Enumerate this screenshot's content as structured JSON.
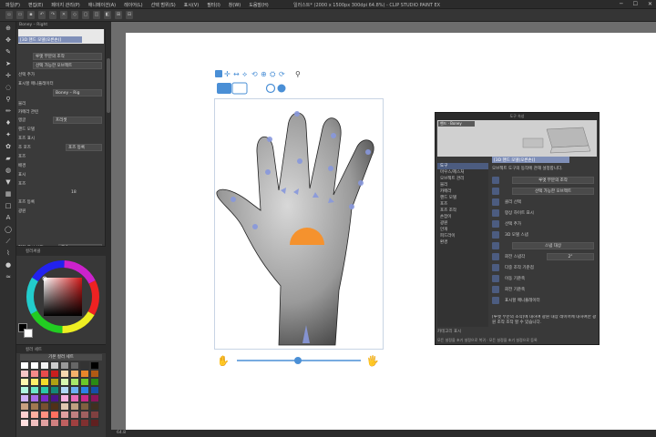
{
  "app": {
    "title": "일러스트* (2000 x 1500px 300dpi 64.8%) - CLIP STUDIO PAINT EX",
    "menu": [
      "파일(F)",
      "편집(E)",
      "페이지 관리(P)",
      "애니메이션(A)",
      "레이어(L)",
      "선택 범위(S)",
      "표시(V)",
      "필터(I)",
      "창(W)",
      "도움말(H)"
    ],
    "window_controls": [
      "─",
      "☐",
      "✕"
    ]
  },
  "subtool": {
    "header": "Boney – Right",
    "selected": "[3D 핸드 모델(오른손)]",
    "rows": [
      "루엣 부분의 조작",
      "선택 가능한 오브젝트",
      "선택 추가",
      "표시할 매니퓰레이터",
      "Boney – Rig",
      "물리",
      "카메라 관련",
      "앵글",
      "프리셋",
      "핸드 모델",
      "포즈 표시",
      "조 포즈",
      "포즈 등록",
      "포즈",
      "배경",
      "표시",
      "포즈",
      "포즈 등록",
      "광원",
      "편집 표시 설정",
      "고속"
    ],
    "bottom_label": "편집 표시 설정",
    "bottom_value": "고속",
    "value_18": "18"
  },
  "color_panel": {
    "title": "컬러써클"
  },
  "palette_panel": {
    "title": "컬러 세트",
    "set_name": "기본 컬러 세트"
  },
  "palette_colors": [
    "#ffffff",
    "#ffffff",
    "#f2f2f2",
    "#cccccc",
    "#999999",
    "#666666",
    "#333333",
    "#000000",
    "#f7c7c7",
    "#f48a8a",
    "#e84c4c",
    "#c81e1e",
    "#f7d8b0",
    "#f4b16b",
    "#e8862a",
    "#b05a14",
    "#fff7b0",
    "#fff06b",
    "#f2dc2a",
    "#b0a014",
    "#d8f7b0",
    "#a8e86b",
    "#6bc82a",
    "#2a8a14",
    "#b0f7e0",
    "#6be8c8",
    "#2ac8a8",
    "#148a78",
    "#b0d8f7",
    "#6bb0f4",
    "#2a82e8",
    "#1450a8",
    "#d0b0f7",
    "#a86be8",
    "#7a2ac8",
    "#4a148a",
    "#f7b0e0",
    "#e86bb8",
    "#c82a8a",
    "#8a145a",
    "#c8a080",
    "#a07850",
    "#785030",
    "#503018",
    "#e0c8b0",
    "#c0a080",
    "#806040",
    "#403020",
    "#ffd0d0",
    "#ffb0a0",
    "#ff9080",
    "#ff7060",
    "#e0a0a0",
    "#c08080",
    "#a06060",
    "#804040",
    "#ffe0e0",
    "#f0c0c0",
    "#e0a0a0",
    "#d08080",
    "#c06060",
    "#a04040",
    "#803030",
    "#602020"
  ],
  "dialog": {
    "header": "도구 속성",
    "preview_chip": "핸드 · Boney",
    "selected": "[3D 핸드 모델(오른손)]",
    "tree": [
      "도구",
      "마우스/제스처",
      "오브젝트 관리",
      "물리",
      "카메라",
      "핸드 모델",
      "포즈",
      "포즈 조작",
      "손잡이",
      "광원",
      "안개",
      "피드라이",
      "환경"
    ],
    "tree_selected_index": 0,
    "description": "오브젝트 도구의 동작에 관해 설정합니다.",
    "rows": [
      {
        "label": "",
        "value": "루엣 부분의 조작"
      },
      {
        "label": "",
        "value": "선택 가능한 오브젝트"
      },
      {
        "label": "클리 선택",
        "value": ""
      },
      {
        "label": "항상 하이트 표시",
        "value": ""
      },
      {
        "label": "선택 추가",
        "value": ""
      },
      {
        "label": "3D 모델 스냅",
        "value": ""
      },
      {
        "label": "",
        "value": "스냅 대상"
      },
      {
        "label": "회전 스냅각",
        "value": "2°"
      },
      {
        "label": "다중 조작 기준점",
        "value": ""
      },
      {
        "label": "이동 기준축",
        "value": ""
      },
      {
        "label": "회전 기준축",
        "value": ""
      },
      {
        "label": "표시할 매니퓰레이터",
        "value": ""
      }
    ],
    "notice": "[루엣 부분의 조작]에 대하여 광원 대상 레이어에 대하여만 광원 조작 조작 할 수 있습니다.",
    "category_label": "카테고리 표시",
    "bottom_text": "모든 설정을 초기 설정으로 복귀 · 모든 설정을 초기 설정으로 등록"
  },
  "status": {
    "zoom": "64.8"
  },
  "colors": {
    "accent": "#7f8fb8",
    "orange": "#f5922e",
    "blue_handle": "#4a8fd6",
    "paper": "#ffffff",
    "canvas_bg": "#6d6d6d"
  }
}
